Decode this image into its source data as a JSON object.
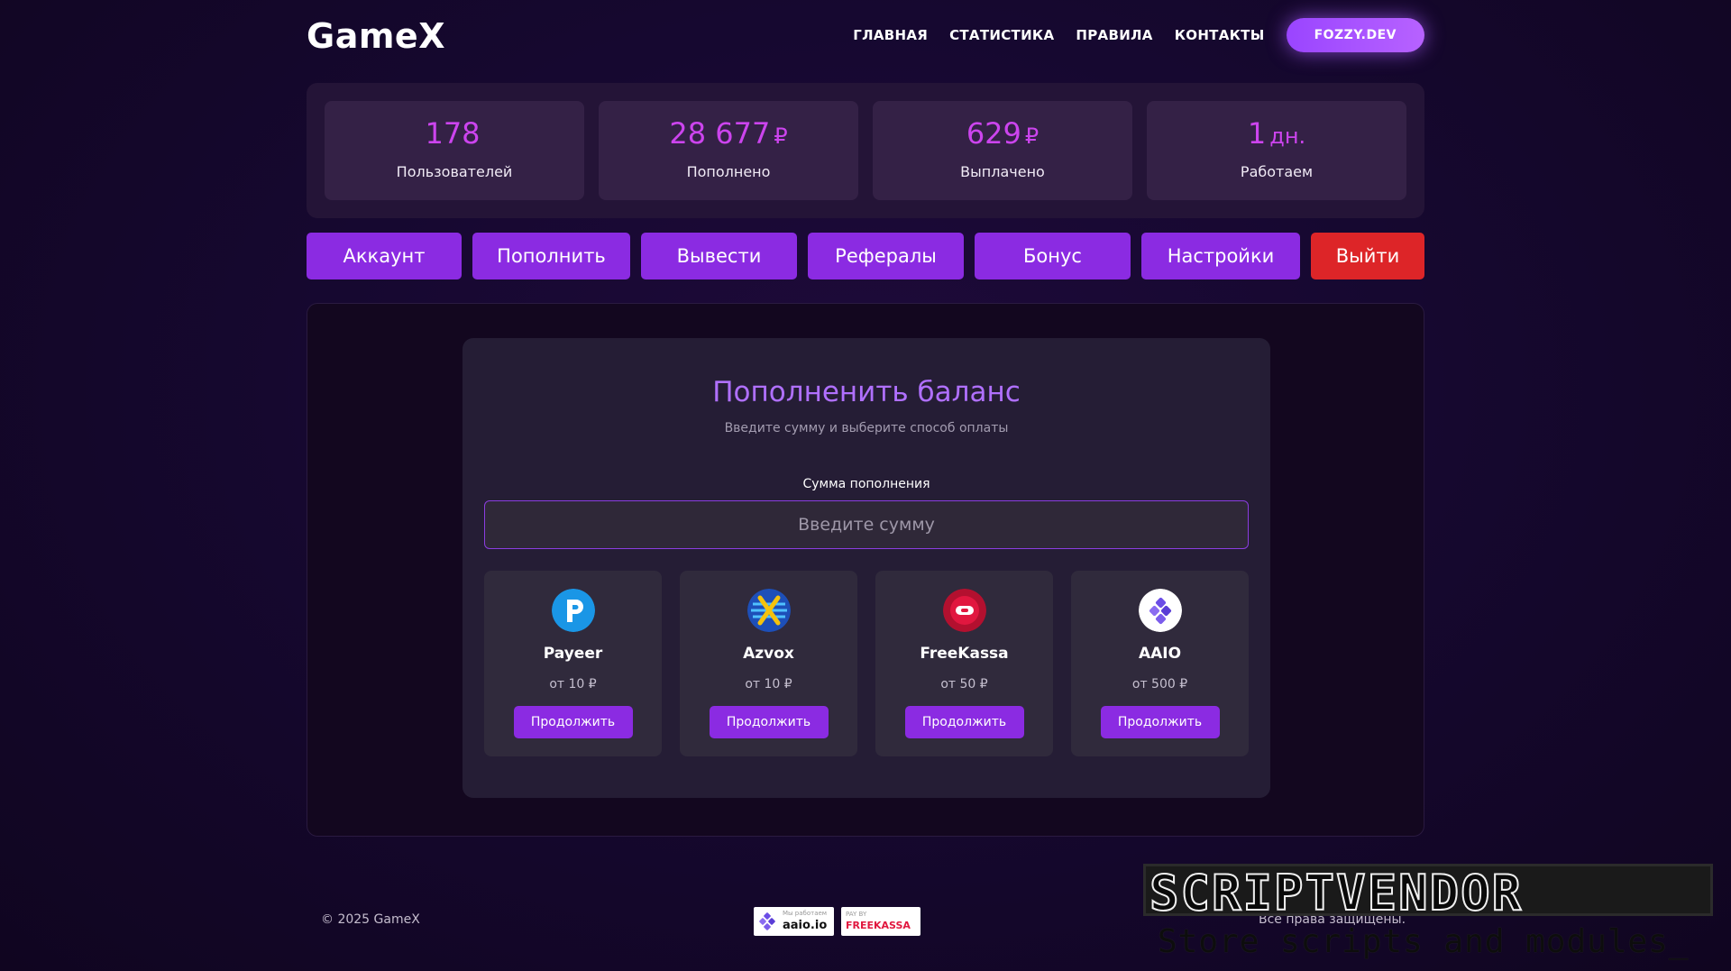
{
  "header": {
    "logo": "GameX",
    "nav": [
      "ГЛАВНАЯ",
      "СТАТИСТИКА",
      "ПРАВИЛА",
      "КОНТАКТЫ"
    ],
    "profile_button": "FOZZY.DEV"
  },
  "stats": [
    {
      "value": "178",
      "unit": "",
      "label": "Пользователей"
    },
    {
      "value": "28 677",
      "unit": "₽",
      "label": "Пополнено"
    },
    {
      "value": "629",
      "unit": "₽",
      "label": "Выплачено"
    },
    {
      "value": "1",
      "unit": "дн.",
      "label": "Работаем"
    }
  ],
  "actions": [
    "Аккаунт",
    "Пополнить",
    "Вывести",
    "Рефералы",
    "Бонус",
    "Настройки",
    "Выйти"
  ],
  "deposit": {
    "title": "Пополненить баланс",
    "subtitle": "Введите сумму и выберите способ оплаты",
    "amount_label": "Сумма пополнения",
    "amount_placeholder": "Введите сумму",
    "amount_value": "",
    "methods": [
      {
        "name": "Payeer",
        "min": "от 10 ₽",
        "button": "Продолжить",
        "icon": "payeer-icon"
      },
      {
        "name": "Azvox",
        "min": "от 10 ₽",
        "button": "Продолжить",
        "icon": "azvox-icon"
      },
      {
        "name": "FreeKassa",
        "min": "от 50 ₽",
        "button": "Продолжить",
        "icon": "freekassa-icon"
      },
      {
        "name": "AAIO",
        "min": "от 500 ₽",
        "button": "Продолжить",
        "icon": "aaio-icon"
      }
    ]
  },
  "footer": {
    "copyright": "© 2025 GameX",
    "rights": "Все права защищены.",
    "badge_aaio_small": "Мы работаем",
    "badge_aaio_main": "aaio.io",
    "badge_fk_small": "PAY BY",
    "badge_fk_main": "FREEKASSA"
  },
  "watermark": {
    "title": "SCRIPTVENDOR",
    "tagline": "Store scripts and modules_"
  },
  "colors": {
    "accent": "#8b2be2",
    "stat_value": "#cc44ee",
    "title": "#b070ff",
    "danger": "#dd2528"
  }
}
